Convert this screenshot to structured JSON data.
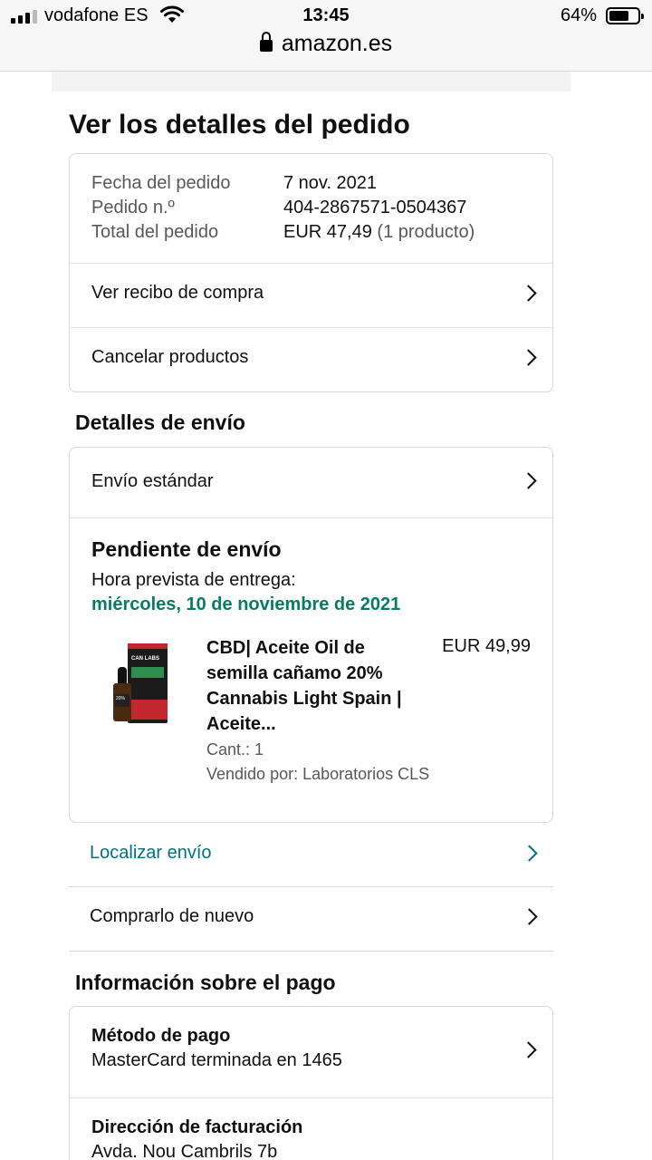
{
  "status_bar": {
    "carrier": "vodafone ES",
    "time": "13:45",
    "battery": "64%",
    "battery_level": 0.64
  },
  "browser": {
    "url": "amazon.es"
  },
  "page": {
    "title": "Ver los detalles del pedido"
  },
  "order_summary": {
    "date_label": "Fecha del pedido",
    "date_value": "7 nov. 2021",
    "number_label": "Pedido n.º",
    "number_value": "404-2867571-0504367",
    "total_label": "Total del pedido",
    "total_value": "EUR 47,49",
    "total_count": "(1 producto)"
  },
  "order_actions": {
    "receipt": "Ver recibo de compra",
    "cancel": "Cancelar productos"
  },
  "shipping": {
    "heading": "Detalles de envío",
    "method": "Envío estándar",
    "status": "Pendiente de envío",
    "eta_label": "Hora prevista de entrega:",
    "eta_date": "miércoles, 10 de noviembre de 2021",
    "product": {
      "title_lines": [
        "CBD| Aceite Oil de",
        "semilla cañamo 20%",
        "Cannabis Light Spain |",
        "Aceite..."
      ],
      "price": "EUR 49,99",
      "qty": "Cant.: 1",
      "seller": "Vendido por: Laboratorios CLS",
      "image_text": "CAN LABS",
      "image_percent": "20%"
    },
    "track": "Localizar envío",
    "buy_again": "Comprarlo de nuevo"
  },
  "payment": {
    "heading": "Información sobre el pago",
    "method_label": "Método de pago",
    "method_value": "MasterCard terminada en 1465",
    "billing_label": "Dirección de facturación",
    "billing_value": "Avda. Nou Cambrils 7b"
  },
  "colors": {
    "green": "#067D62",
    "link": "#007185",
    "text": "#0F1111",
    "muted": "#565959",
    "border": "#d5d9d9"
  }
}
